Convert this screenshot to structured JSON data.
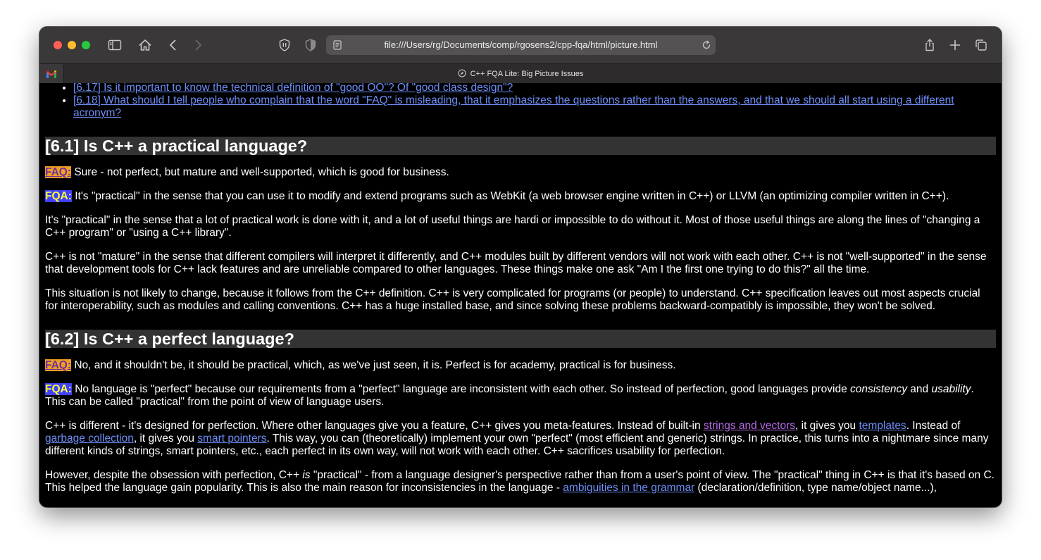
{
  "browser": {
    "url": "file:///Users/rg/Documents/comp/rgosens2/cpp-fqa/html/picture.html",
    "tab_title": "C++ FQA Lite: Big Picture Issues"
  },
  "toc": [
    {
      "text": "[6.17] Is it important to know the technical definition of \"good OO\"? Of \"good class design\"?"
    },
    {
      "text": "[6.18] What should I tell people who complain that the word \"FAQ\" is misleading, that it emphasizes the questions rather than the answers, and that we should all start using a different acronym?"
    }
  ],
  "labels": {
    "faq": "FAQ:",
    "fqa": "FQA:"
  },
  "s1": {
    "heading": "[6.1] Is C++ a practical language?",
    "faq": "Sure - not perfect, but mature and well-supported, which is good for business.",
    "fqa": "It's \"practical\" in the sense that you can use it to modify and extend programs such as WebKit (a web browser engine written in C++) or LLVM (an optimizing compiler written in C++).",
    "p1": "It's \"practical\" in the sense that a lot of practical work is done with it, and a lot of useful things are hardi or impossible to do without it. Most of those useful things are along the lines of \"changing a C++ program\" or \"using a C++ library\".",
    "p2": "C++ is not \"mature\" in the sense that different compilers will interpret it differently, and C++ modules built by different vendors will not work with each other. C++ is not \"well-supported\" in the sense that development tools for C++ lack features and are unreliable compared to other languages. These things make one ask \"Am I the first one trying to do this?\" all the time.",
    "p3": "This situation is not likely to change, because it follows from the C++ definition. C++ is very complicated for programs (or people) to understand. C++ specification leaves out most aspects crucial for interoperability, such as modules and calling conventions. C++ has a huge installed base, and since solving these problems backward-compatibly is impossible, they won't be solved."
  },
  "s2": {
    "heading": "[6.2] Is C++ a perfect language?",
    "faq": "No, and it shouldn't be, it should be practical, which, as we've just seen, it is. Perfect is for academy, practical is for business.",
    "fqa_a": "No language is \"perfect\" because our requirements from a \"perfect\" language are inconsistent with each other. So instead of perfection, good languages provide ",
    "fqa_em1": "consistency",
    "fqa_b": " and ",
    "fqa_em2": "usability",
    "fqa_c": ". This can be called \"practical\" from the point of view of language users.",
    "p1_a": "C++ is different - it's designed for perfection. Where other languages give you a feature, C++ gives you meta-features. Instead of built-in ",
    "p1_link1": "strings and vectors",
    "p1_b": ", it gives you ",
    "p1_link2": "templates",
    "p1_c": ". Instead of ",
    "p1_link3": "garbage collection",
    "p1_d": ", it gives you ",
    "p1_link4": "smart pointers",
    "p1_e": ". This way, you can (theoretically) implement your own \"perfect\" (most efficient and generic) strings. In practice, this turns into a nightmare since many different kinds of strings, smart pointers, etc., each perfect in its own way, will not work with each other. C++ sacrifices usability for perfection.",
    "p2_a": "However, despite the obsession with perfection, C++ ",
    "p2_em": "is",
    "p2_b": " \"practical\" - from a language designer's perspective rather than from a user's point of view. The \"practical\" thing in C++ is that it's based on C. This helped the language gain popularity. This is also the main reason for inconsistencies in the language - ",
    "p2_link": "ambiguities in the grammar",
    "p2_c": " (declaration/definition, type name/object name...),"
  }
}
